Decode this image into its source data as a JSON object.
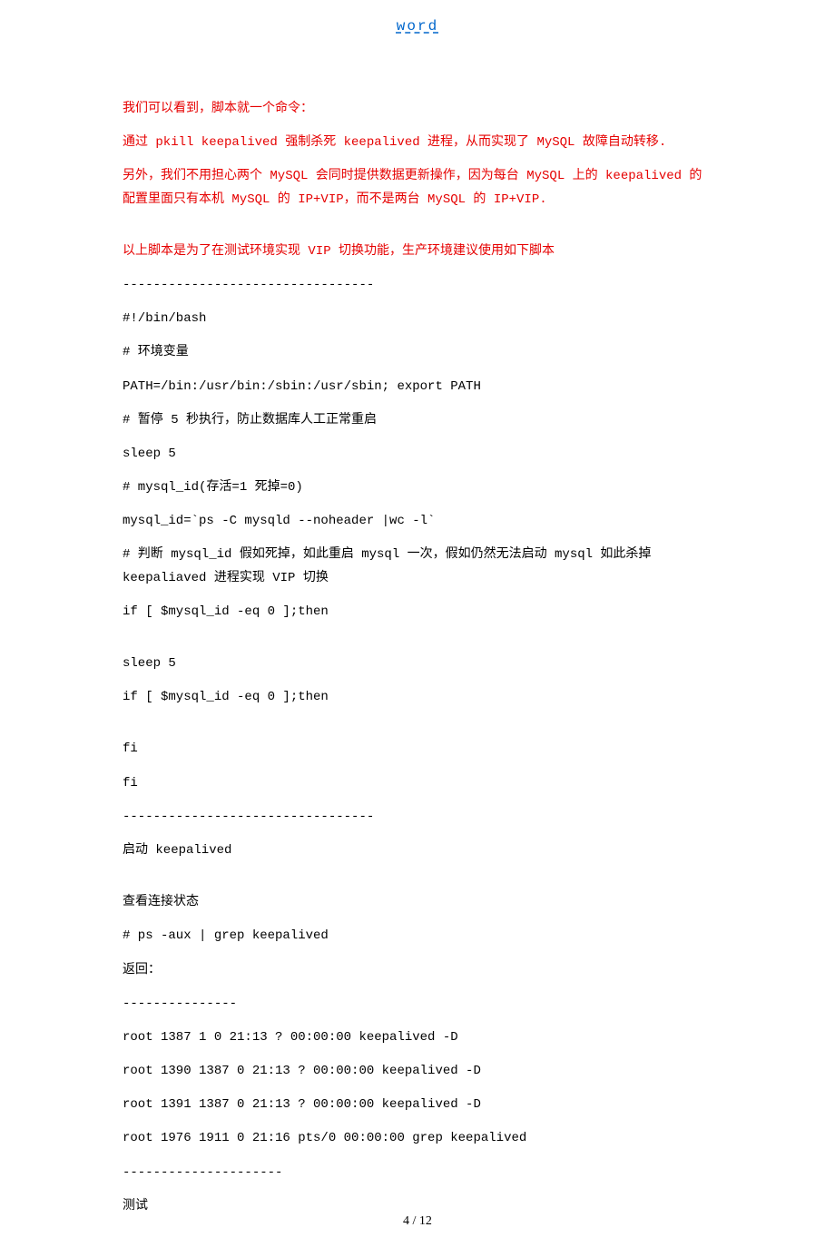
{
  "header": "word",
  "lines": {
    "l1": "我们可以看到，脚本就一个命令：",
    "l2": "通过 pkill keepalived 强制杀死 keepalived 进程，从而实现了 MySQL 故障自动转移.",
    "l3": "另外，我们不用担心两个 MySQL 会同时提供数据更新操作，因为每台 MySQL 上的 keepalived 的配置里面只有本机 MySQL 的 IP+VIP，而不是两台 MySQL 的 IP+VIP.",
    "l4": "以上脚本是为了在测试环境实现 VIP 切换功能，生产环境建议使用如下脚本",
    "sep1": "---------------------------------",
    "l5": "#!/bin/bash",
    "l6": "# 环境变量",
    "l7": "PATH=/bin:/usr/bin:/sbin:/usr/sbin; export PATH",
    "l8": "# 暂停 5 秒执行，防止数据库人工正常重启",
    "l9": "sleep 5",
    "l10": "# mysql_id(存活=1 死掉=0)",
    "l11": "mysql_id=`ps -C mysqld --noheader |wc -l`",
    "l12": "# 判断 mysql_id 假如死掉，如此重启 mysql 一次，假如仍然无法启动 mysql 如此杀掉 keepaliaved 进程实现 VIP 切换",
    "l13": "if [ $mysql_id -eq 0 ];then",
    "l14": "sleep 5",
    "l15": "if [ $mysql_id -eq 0 ];then",
    "l16": "fi",
    "l17": "fi",
    "sep2": "---------------------------------",
    "l18": "启动 keepalived",
    "l19": "查看连接状态",
    "l20": "# ps -aux | grep keepalived",
    "l21": "返回：",
    "sep3": "---------------",
    "l22": "root 1387 1 0 21:13 ? 00:00:00 keepalived -D",
    "l23": "root 1390 1387 0 21:13 ? 00:00:00 keepalived -D",
    "l24": "root 1391 1387 0 21:13 ? 00:00:00 keepalived -D",
    "l25": "root 1976 1911 0 21:16 pts/0 00:00:00 grep keepalived",
    "sep4": "---------------------",
    "l26": "测试"
  },
  "footer": "4 / 12"
}
